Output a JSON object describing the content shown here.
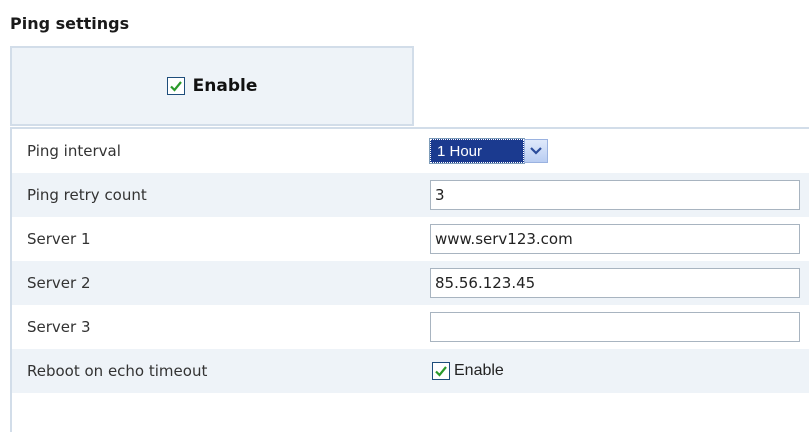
{
  "title": "Ping settings",
  "enable_tab": {
    "checked": true,
    "label": "Enable"
  },
  "rows": [
    {
      "label": "Ping interval",
      "type": "select",
      "value": "1 Hour"
    },
    {
      "label": "Ping retry count",
      "type": "text",
      "value": "3"
    },
    {
      "label": "Server 1",
      "type": "text",
      "value": "www.serv123.com"
    },
    {
      "label": "Server 2",
      "type": "text",
      "value": "85.56.123.45"
    },
    {
      "label": "Server 3",
      "type": "text",
      "value": ""
    },
    {
      "label": "Reboot on echo timeout",
      "type": "checkbox",
      "checked": true,
      "checkbox_label": "Enable"
    }
  ],
  "colors": {
    "check": "#2a9a2a",
    "row_shade": "#eef3f8",
    "border": "#d2dde9",
    "select_highlight": "#1b3a8f"
  },
  "icons": {
    "checkbox": "check-icon",
    "dropdown": "chevron-down-icon"
  }
}
